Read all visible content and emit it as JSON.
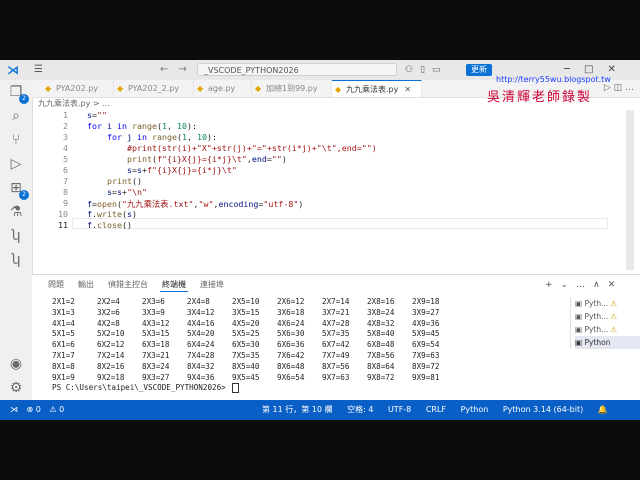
{
  "titlebar": {
    "search_text": "_VSCODE_PYTHON2026",
    "update_label": "更新",
    "url": "http://terry55wu.blogspot.tw",
    "watermark": "吳清輝老師錄製"
  },
  "activity_badges": [
    "2",
    "2"
  ],
  "tabs": [
    {
      "label": "PYA202.py",
      "active": false
    },
    {
      "label": "PYA202_2.py",
      "active": false
    },
    {
      "label": "age.py",
      "active": false
    },
    {
      "label": "加總1到99.py",
      "active": false
    },
    {
      "label": "九九乘法表.py",
      "active": true
    }
  ],
  "breadcrumb": "九九乘法表.py > ...",
  "editor": {
    "line_numbers": [
      "1",
      "2",
      "3",
      "4",
      "5",
      "6",
      "7",
      "8",
      "9",
      "10",
      "11"
    ]
  },
  "panel": {
    "tabs": [
      "問題",
      "輸出",
      "偵錯主控台",
      "終端機",
      "連接埠"
    ],
    "active_tab": "終端機",
    "terminal_rows": [
      [
        "2X1=2",
        "2X2=4",
        "2X3=6",
        "2X4=8",
        "2X5=10",
        "2X6=12",
        "2X7=14",
        "2X8=16",
        "2X9=18"
      ],
      [
        "3X1=3",
        "3X2=6",
        "3X3=9",
        "3X4=12",
        "3X5=15",
        "3X6=18",
        "3X7=21",
        "3X8=24",
        "3X9=27"
      ],
      [
        "4X1=4",
        "4X2=8",
        "4X3=12",
        "4X4=16",
        "4X5=20",
        "4X6=24",
        "4X7=28",
        "4X8=32",
        "4X9=36"
      ],
      [
        "5X1=5",
        "5X2=10",
        "5X3=15",
        "5X4=20",
        "5X5=25",
        "5X6=30",
        "5X7=35",
        "5X8=40",
        "5X9=45"
      ],
      [
        "6X1=6",
        "6X2=12",
        "6X3=18",
        "6X4=24",
        "6X5=30",
        "6X6=36",
        "6X7=42",
        "6X8=48",
        "6X9=54"
      ],
      [
        "7X1=7",
        "7X2=14",
        "7X3=21",
        "7X4=28",
        "7X5=35",
        "7X6=42",
        "7X7=49",
        "7X8=56",
        "7X9=63"
      ],
      [
        "8X1=8",
        "8X2=16",
        "8X3=24",
        "8X4=32",
        "8X5=40",
        "8X6=48",
        "8X7=56",
        "8X8=64",
        "8X9=72"
      ],
      [
        "9X1=9",
        "9X2=18",
        "9X3=27",
        "9X4=36",
        "9X5=45",
        "9X6=54",
        "9X7=63",
        "9X8=72",
        "9X9=81"
      ]
    ],
    "prompt": "PS C:\\Users\\taipei\\_VSCODE_PYTHON2026> ",
    "terminal_list": [
      "Pyth...",
      "Pyth...",
      "Pyth...",
      "Python"
    ]
  },
  "status": {
    "errors": "0",
    "warnings": "0",
    "position": "第 11 行，第 10 欄",
    "spaces": "空格: 4",
    "encoding": "UTF-8",
    "eol": "CRLF",
    "language": "Python",
    "interpreter": "Python 3.14 (64-bit)"
  }
}
